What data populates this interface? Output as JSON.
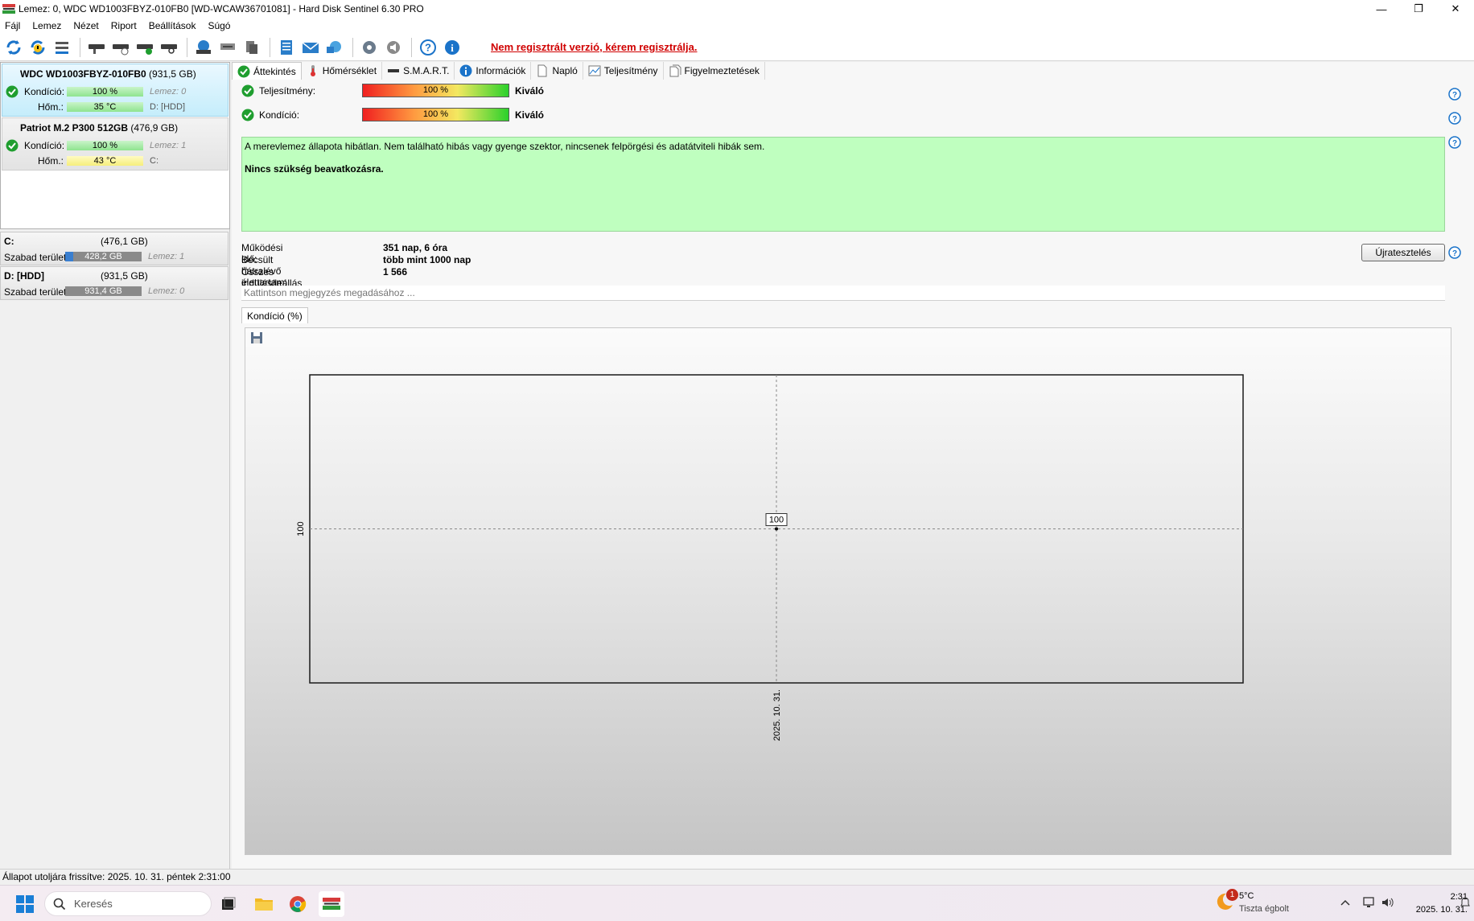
{
  "window": {
    "title": "Lemez: 0, WDC WD1003FBYZ-010FB0 [WD-WCAW36701081]  -  Hard Disk Sentinel 6.30 PRO",
    "controls": {
      "minimize": "—",
      "maximize": "❐",
      "close": "✕"
    }
  },
  "menu": [
    "Fájl",
    "Lemez",
    "Nézet",
    "Riport",
    "Beállítások",
    "Súgó"
  ],
  "toolbar": {
    "notice": "Nem regisztrált verzió, kérem regisztrálja."
  },
  "disks": [
    {
      "name": "WDC WD1003FBYZ-010FB0",
      "size": "(931,5 GB)",
      "health_label": "Kondíció:",
      "health_value": "100 %",
      "health_pct": 100,
      "disk_index": "Lemez: 0",
      "temp_label": "Hőm.:",
      "temp_value": "35 °C",
      "drives": "D: [HDD]"
    },
    {
      "name": "Patriot M.2 P300 512GB",
      "size": "(476,9 GB)",
      "health_label": "Kondíció:",
      "health_value": "100 %",
      "health_pct": 100,
      "disk_index": "Lemez: 1",
      "temp_label": "Hőm.:",
      "temp_value": "43 °C",
      "drives": "C:"
    }
  ],
  "volumes": [
    {
      "name": "C:",
      "size": "(476,1 GB)",
      "free_label": "Szabad terület",
      "free_value": "428,2 GB",
      "used_fraction": 0.1,
      "disk_index": "Lemez: 1"
    },
    {
      "name": "D: [HDD]",
      "size": "(931,5 GB)",
      "free_label": "Szabad terület",
      "free_value": "931,4 GB",
      "used_fraction": 0.0,
      "disk_index": "Lemez: 0"
    }
  ],
  "tabs": [
    "Áttekintés",
    "Hőmérséklet",
    "S.M.A.R.T.",
    "Információk",
    "Napló",
    "Teljesítmény",
    "Figyelmeztetések"
  ],
  "overview": {
    "performance_label": "Teljesítmény:",
    "performance_value": "100 %",
    "performance_verdict": "Kiváló",
    "health_label": "Kondíció:",
    "health_value": "100 %",
    "health_verdict": "Kiváló",
    "status_text": "A merevlemez állapota hibátlan. Nem található hibás vagy gyenge szektor, nincsenek felpörgési és adatátviteli hibák sem.",
    "status_action": "Nincs szükség beavatkozásra.",
    "stats": [
      {
        "label": "Működési idő:",
        "value": "351 nap, 6 óra"
      },
      {
        "label": "Becsült hátralévő élettartam:",
        "value": "több mint 1000 nap"
      },
      {
        "label": "Összes indulás/leállás száma:",
        "value": "1 566"
      }
    ],
    "retest_button": "Újratesztelés",
    "note_placeholder": "Kattintson megjegyzés megadásához ..."
  },
  "chart_tab": "Kondíció  (%)",
  "chart_data": {
    "type": "line",
    "x": [
      "2025. 10. 31."
    ],
    "series": [
      {
        "values": [
          100
        ]
      }
    ],
    "y_tick_labels": [
      "100"
    ],
    "x_tick_labels": [
      "2025. 10. 31."
    ],
    "point_labels": [
      "100"
    ],
    "ylim": [
      0,
      200
    ]
  },
  "statusbar": "Állapot utoljára frissítve: 2025. 10. 31. péntek 2:31:00",
  "taskbar": {
    "search_placeholder": "Keresés",
    "weather_badge": "1",
    "weather_temp": "5°C",
    "weather_desc": "Tiszta égbolt",
    "time": "2:31",
    "date": "2025. 10. 31."
  },
  "colors": {
    "accent_red": "#d00000",
    "status_ok_bg": "#bfffbf",
    "check_green": "#1f9e2f",
    "selected_card": "#c5edfb"
  }
}
